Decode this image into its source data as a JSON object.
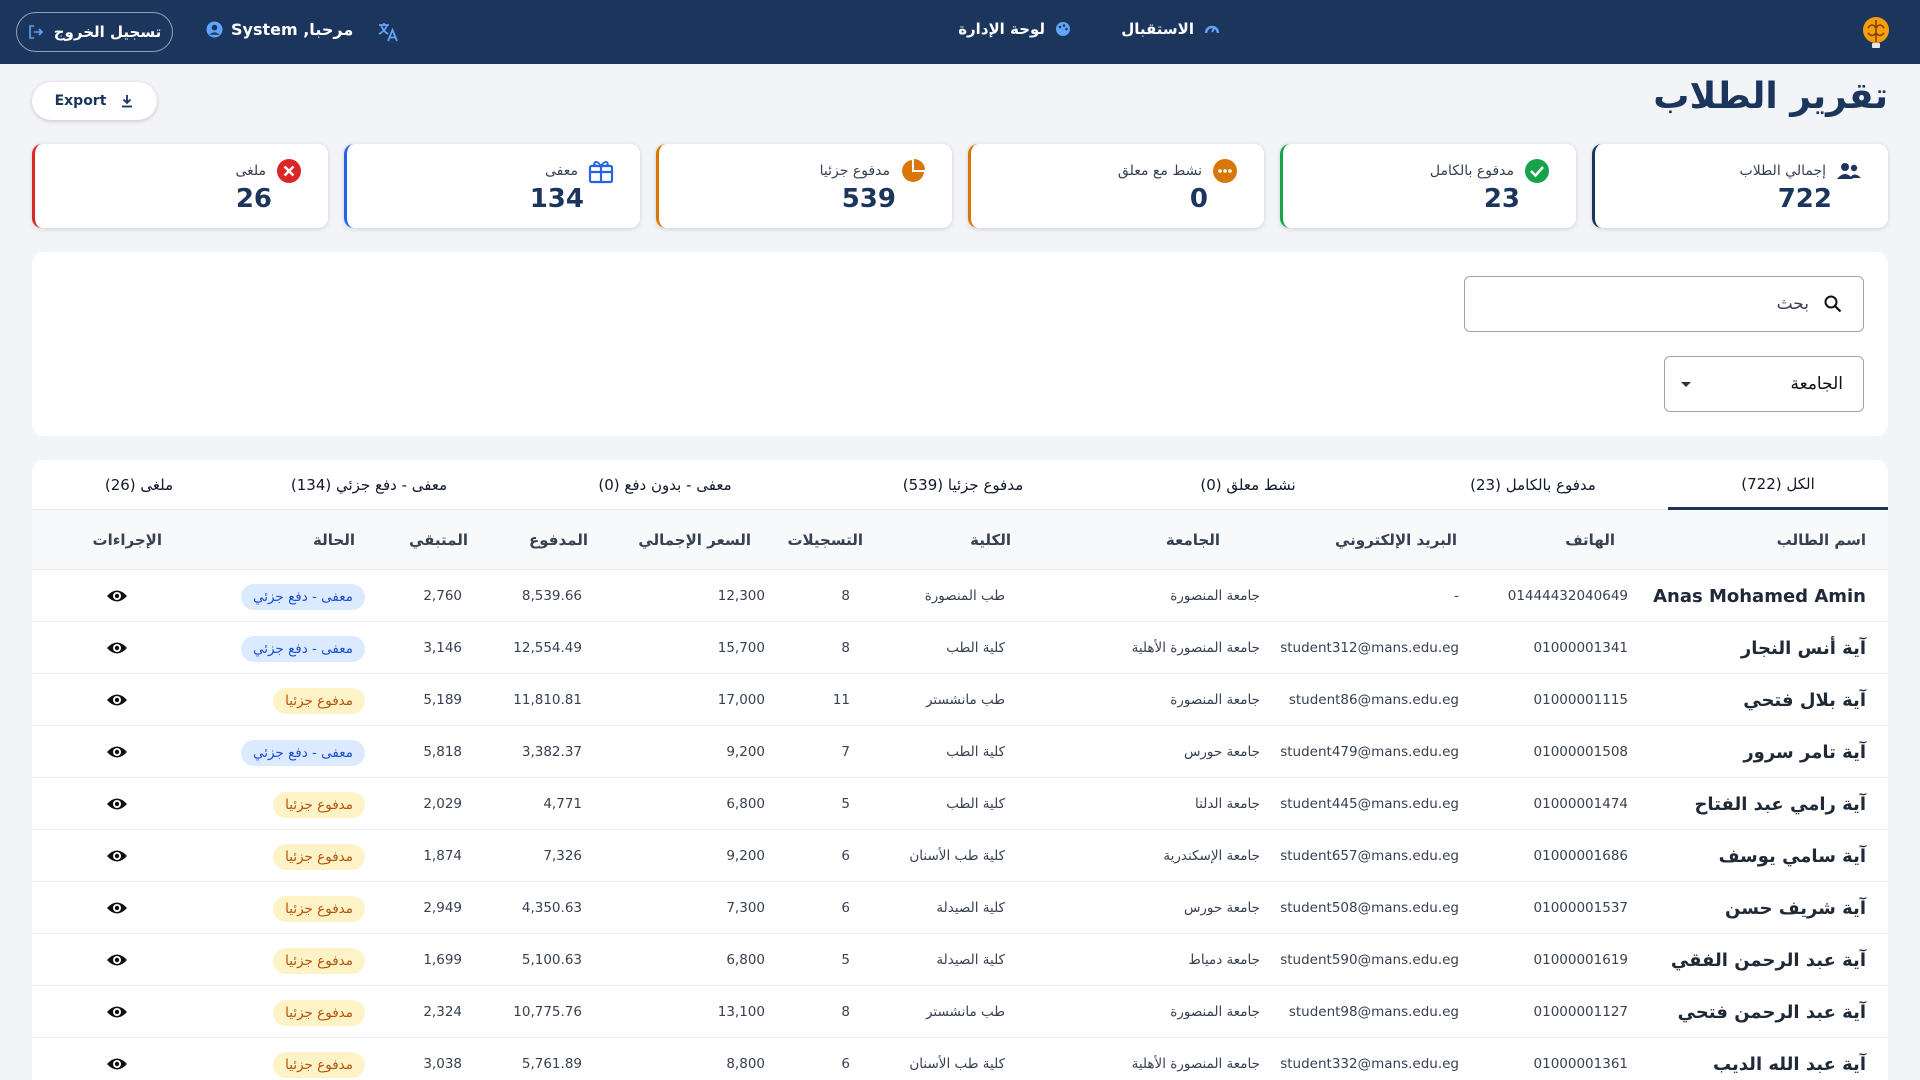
{
  "topbar": {
    "nav_home": "الاستقبال",
    "nav_admin": "لوحة الإدارة",
    "greeting": "مرحبا, System",
    "logout": "تسجيل الخروج"
  },
  "page": {
    "title": "تقرير الطلاب",
    "export_label": "Export"
  },
  "stats": [
    {
      "label": "إجمالي الطلاب",
      "value": "722",
      "icon": "users-icon",
      "color": "#1b355d"
    },
    {
      "label": "مدفوع بالكامل",
      "value": "23",
      "icon": "check-circle-icon",
      "color": "#16a34a"
    },
    {
      "label": "نشط مع معلق",
      "value": "0",
      "icon": "more-circle-icon",
      "color": "#d97706"
    },
    {
      "label": "مدفوع جزئيا",
      "value": "539",
      "icon": "pie-chart-icon",
      "color": "#d97706"
    },
    {
      "label": "معفى",
      "value": "134",
      "icon": "gift-icon",
      "color": "#2563eb"
    },
    {
      "label": "ملغى",
      "value": "26",
      "icon": "cancel-circle-icon",
      "color": "#dc2626"
    }
  ],
  "filters": {
    "search_placeholder": "بحث",
    "university_label": "الجامعة"
  },
  "tabs": [
    {
      "label": "الكل (722)",
      "active": true
    },
    {
      "label": "مدفوع بالكامل (23)"
    },
    {
      "label": "نشط معلق (0)"
    },
    {
      "label": "مدفوع جزئيا (539)"
    },
    {
      "label": "معفى - بدون دفع (0)"
    },
    {
      "label": "معفى - دفع جزئي (134)"
    },
    {
      "label": "ملغى (26)"
    }
  ],
  "columns": [
    "اسم الطالب",
    "الهاتف",
    "البريد الإلكتروني",
    "الجامعة",
    "الكلية",
    "التسجيلات",
    "السعر الإجمالي",
    "المدفوع",
    "المتبقي",
    "الحالة",
    "الإجراءات"
  ],
  "status_styles": {
    "exempt_partial": {
      "bg": "#dbeafe",
      "fg": "#1d4ed8"
    },
    "partial": {
      "bg": "#fef3c7",
      "fg": "#b45309"
    }
  },
  "rows": [
    {
      "name": "Anas Mohamed Amin",
      "phone": "01444432040649",
      "email": "-",
      "university": "جامعة المنصورة",
      "faculty": "طب المنصورة",
      "enrollments": "8",
      "total": "12,300",
      "paid": "8,539.66",
      "remaining": "2,760",
      "status": "معفى - دفع جزئي",
      "status_type": "exempt_partial"
    },
    {
      "name": "آية أنس النجار",
      "phone": "01000001341",
      "email": "student312@mans.edu.eg",
      "university": "جامعة المنصورة الأهلية",
      "faculty": "كلية الطب",
      "enrollments": "8",
      "total": "15,700",
      "paid": "12,554.49",
      "remaining": "3,146",
      "status": "معفى - دفع جزئي",
      "status_type": "exempt_partial"
    },
    {
      "name": "آية بلال فتحي",
      "phone": "01000001115",
      "email": "student86@mans.edu.eg",
      "university": "جامعة المنصورة",
      "faculty": "طب مانشستر",
      "enrollments": "11",
      "total": "17,000",
      "paid": "11,810.81",
      "remaining": "5,189",
      "status": "مدفوع جزئيا",
      "status_type": "partial"
    },
    {
      "name": "آية تامر سرور",
      "phone": "01000001508",
      "email": "student479@mans.edu.eg",
      "university": "جامعة حورس",
      "faculty": "كلية الطب",
      "enrollments": "7",
      "total": "9,200",
      "paid": "3,382.37",
      "remaining": "5,818",
      "status": "معفى - دفع جزئي",
      "status_type": "exempt_partial"
    },
    {
      "name": "آية رامي عبد الفتاح",
      "phone": "01000001474",
      "email": "student445@mans.edu.eg",
      "university": "جامعة الدلتا",
      "faculty": "كلية الطب",
      "enrollments": "5",
      "total": "6,800",
      "paid": "4,771",
      "remaining": "2,029",
      "status": "مدفوع جزئيا",
      "status_type": "partial"
    },
    {
      "name": "آية سامي يوسف",
      "phone": "01000001686",
      "email": "student657@mans.edu.eg",
      "university": "جامعة الإسكندرية",
      "faculty": "كلية طب الأسنان",
      "enrollments": "6",
      "total": "9,200",
      "paid": "7,326",
      "remaining": "1,874",
      "status": "مدفوع جزئيا",
      "status_type": "partial"
    },
    {
      "name": "آية شريف حسن",
      "phone": "01000001537",
      "email": "student508@mans.edu.eg",
      "university": "جامعة حورس",
      "faculty": "كلية الصيدلة",
      "enrollments": "6",
      "total": "7,300",
      "paid": "4,350.63",
      "remaining": "2,949",
      "status": "مدفوع جزئيا",
      "status_type": "partial"
    },
    {
      "name": "آية عبد الرحمن الفقي",
      "phone": "01000001619",
      "email": "student590@mans.edu.eg",
      "university": "جامعة دمياط",
      "faculty": "كلية الصيدلة",
      "enrollments": "5",
      "total": "6,800",
      "paid": "5,100.63",
      "remaining": "1,699",
      "status": "مدفوع جزئيا",
      "status_type": "partial"
    },
    {
      "name": "آية عبد الرحمن فتحي",
      "phone": "01000001127",
      "email": "student98@mans.edu.eg",
      "university": "جامعة المنصورة",
      "faculty": "طب مانشستر",
      "enrollments": "8",
      "total": "13,100",
      "paid": "10,775.76",
      "remaining": "2,324",
      "status": "مدفوع جزئيا",
      "status_type": "partial"
    },
    {
      "name": "آية عبد الله الديب",
      "phone": "01000001361",
      "email": "student332@mans.edu.eg",
      "university": "جامعة المنصورة الأهلية",
      "faculty": "كلية طب الأسنان",
      "enrollments": "6",
      "total": "8,800",
      "paid": "5,761.89",
      "remaining": "3,038",
      "status": "مدفوع جزئيا",
      "status_type": "partial"
    }
  ]
}
